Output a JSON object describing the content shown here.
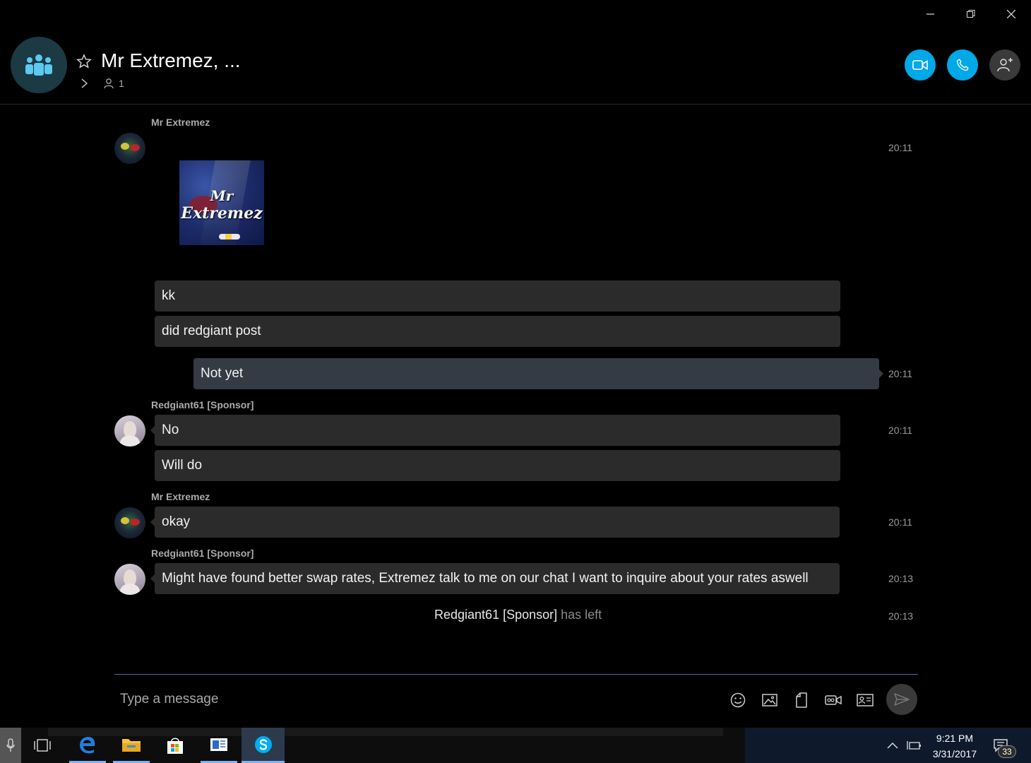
{
  "window": {
    "minimize": "minimize",
    "maximize": "restore",
    "close": "close"
  },
  "header": {
    "title": "Mr Extremez, ...",
    "participants_count": "1",
    "icons": {
      "group": "group-icon",
      "favorite": "star-icon",
      "expand": "chevron-right-icon",
      "people": "person-icon"
    },
    "buttons": {
      "video": "video-call-icon",
      "audio": "phone-icon",
      "add": "add-person-icon"
    },
    "accent": "#00a8e8"
  },
  "messages": [
    {
      "sender": "Mr Extremez",
      "time": "20:11",
      "image_text_1": "Mr",
      "image_text_2": "Extremez"
    },
    {
      "text": "kk"
    },
    {
      "text": "did redgiant post"
    },
    {
      "text": "Not yet",
      "time": "20:11",
      "own": true
    },
    {
      "sender": "Redgiant61 [Sponsor]",
      "text": "No",
      "time": "20:11"
    },
    {
      "text": "Will do"
    },
    {
      "sender": "Mr Extremez",
      "text": "okay",
      "time": "20:11"
    },
    {
      "sender": "Redgiant61 [Sponsor]",
      "text": "Might have found better swap rates, Extremez talk to me on our chat I want to inquire about your rates aswell",
      "time": "20:13"
    }
  ],
  "event": {
    "name": "Redgiant61 [Sponsor]",
    "action": "has left",
    "time": "20:13"
  },
  "composer": {
    "placeholder": "Type a message",
    "icons": [
      "emoji-icon",
      "image-icon",
      "file-icon",
      "video-message-icon",
      "contact-card-icon",
      "send-icon"
    ]
  },
  "taskbar": {
    "apps": [
      "task-view-icon",
      "edge-icon",
      "file-explorer-icon",
      "store-icon",
      "news-icon",
      "skype-icon"
    ],
    "time": "9:21 PM",
    "date": "3/31/2017",
    "notifications": "33"
  }
}
